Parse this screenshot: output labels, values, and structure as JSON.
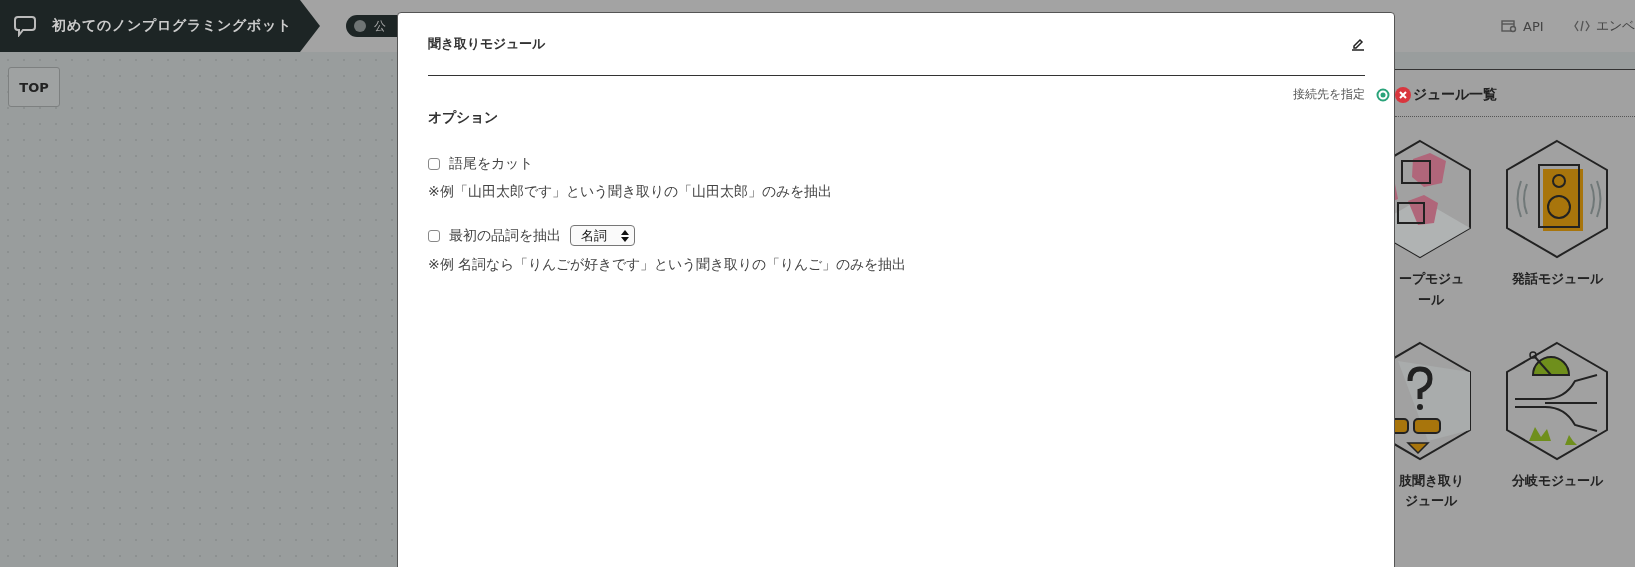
{
  "header": {
    "title": "初めてのノンプログラミングボット",
    "publish_toggle": {
      "label": "公",
      "on": false
    },
    "links": [
      {
        "label": "API",
        "kind": "api"
      },
      {
        "label": "エンベ",
        "kind": "embed"
      }
    ]
  },
  "canvas": {
    "top_button": "TOP"
  },
  "module_panel": {
    "title": "ジュール一覧",
    "modules": [
      {
        "label": "ープモジュール",
        "kind": "boxes"
      },
      {
        "label": "発話モジュール",
        "kind": "speaker"
      },
      {
        "label": "肢聞き取りジュール",
        "kind": "question"
      },
      {
        "label": "分岐モジュール",
        "kind": "branch"
      }
    ]
  },
  "modal": {
    "title": "聞き取りモジュール",
    "connect_label": "接続先を指定",
    "section_title": "オプション",
    "options": [
      {
        "label": "語尾をカット",
        "checked": false,
        "note": "※例「山田太郎です」という聞き取りの「山田太郎」のみを抽出"
      },
      {
        "label": "最初の品詞を抽出",
        "checked": false,
        "select": "名詞",
        "note": "※例 名詞なら「りんごが好きです」という聞き取りの「りんご」のみを抽出"
      }
    ]
  }
}
